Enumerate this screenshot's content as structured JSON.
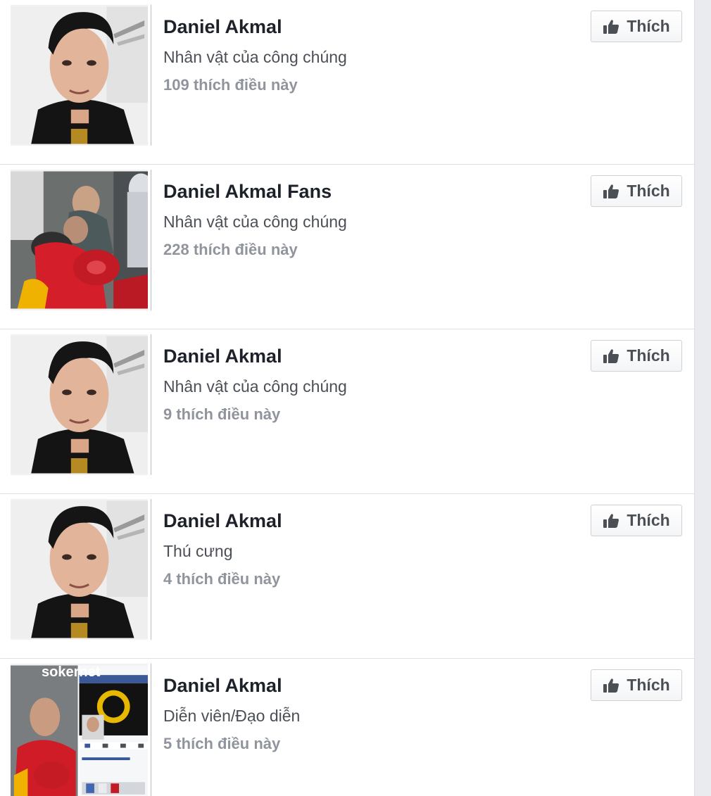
{
  "pages": [
    {
      "name": "Daniel Akmal",
      "category": "Nhân vật của công chúng",
      "likes": "109 thích điều này",
      "button_label": "Thích",
      "photo": "portrait"
    },
    {
      "name": "Daniel Akmal Fans",
      "category": "Nhân vật của công chúng",
      "likes": "228 thích điều này",
      "button_label": "Thích",
      "photo": "crowd"
    },
    {
      "name": "Daniel Akmal",
      "category": "Nhân vật của công chúng",
      "likes": "9 thích điều này",
      "button_label": "Thích",
      "photo": "portrait"
    },
    {
      "name": "Daniel Akmal",
      "category": "Thú cưng",
      "likes": "4 thích điều này",
      "button_label": "Thích",
      "photo": "portrait"
    },
    {
      "name": "Daniel Akmal",
      "category": "Diễn viên/Đạo diễn",
      "likes": "5 thích điều này",
      "button_label": "Thích",
      "photo": "collage"
    }
  ],
  "icons": {
    "like_button_icon": "thumbs-up-icon"
  },
  "collage_watermark": "sokernet",
  "colors": {
    "name_text": "#1d2129",
    "category_text": "#4b4f56",
    "likes_text": "#90949c",
    "divider": "#dddfe2",
    "scroll_gutter": "#e9ebee"
  }
}
